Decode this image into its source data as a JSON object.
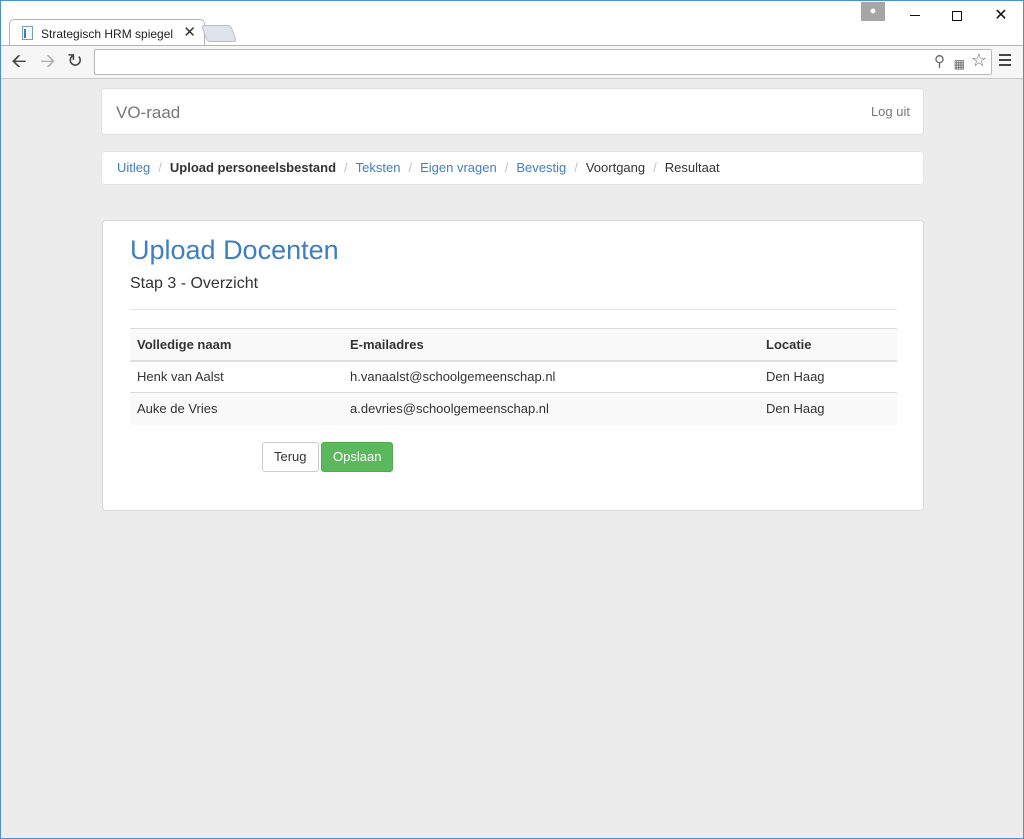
{
  "browser": {
    "tab_title": "Strategisch HRM spiegel",
    "tab_close": "✕",
    "address": "",
    "icons": {
      "back": "arrow-left-icon",
      "forward": "arrow-right-icon",
      "reload": "reload-icon",
      "zoom": "zoom-icon",
      "translate": "translate-icon",
      "bookmark": "star-icon",
      "menu": "hamburger-menu-icon",
      "profile": "person-icon"
    }
  },
  "navbar": {
    "brand": "VO-raad",
    "logout": "Log uit"
  },
  "breadcrumb": {
    "items": [
      {
        "label": "Uitleg",
        "state": "link"
      },
      {
        "label": "Upload personeelsbestand",
        "state": "active"
      },
      {
        "label": "Teksten",
        "state": "link"
      },
      {
        "label": "Eigen vragen",
        "state": "link"
      },
      {
        "label": "Bevestig",
        "state": "link"
      },
      {
        "label": "Voortgang",
        "state": "plain"
      },
      {
        "label": "Resultaat",
        "state": "plain"
      }
    ],
    "separator": "/"
  },
  "panel": {
    "title": "Upload Docenten",
    "subtitle": "Stap 3 - Overzicht"
  },
  "table": {
    "headers": [
      "Volledige naam",
      "E-mailadres",
      "Locatie"
    ],
    "rows": [
      [
        "Henk van Aalst",
        "h.vanaalst@schoolgemeenschap.nl",
        "Den Haag"
      ],
      [
        "Auke de Vries",
        "a.devries@schoolgemeenschap.nl",
        "Den Haag"
      ]
    ]
  },
  "actions": {
    "back_label": "Terug",
    "save_label": "Opslaan"
  },
  "colors": {
    "link": "#3d7fc1",
    "success": "#5cb85c",
    "page_background": "#ececec"
  }
}
